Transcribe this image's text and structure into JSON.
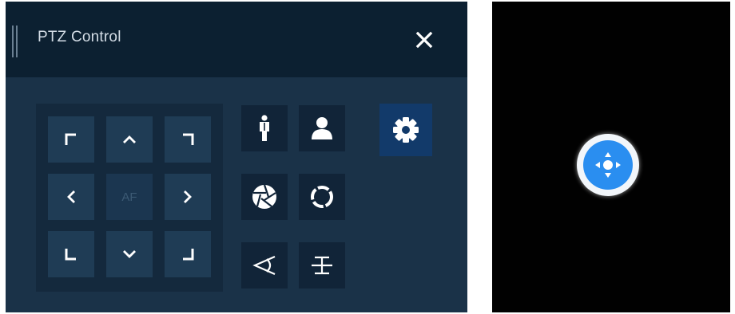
{
  "ptz": {
    "title": "PTZ Control",
    "direction_pad": {
      "center_label": "AF",
      "buttons": [
        "up-left",
        "up",
        "up-right",
        "left",
        "right",
        "down-left",
        "down",
        "down-right"
      ]
    },
    "lens_buttons": [
      "person-icon",
      "user-icon",
      "aperture-icon",
      "iris-ring-icon",
      "zoom-icon",
      "focus-icon"
    ],
    "settings_icon": "gear-icon",
    "close_icon": "close-icon"
  },
  "preview": {
    "floating_button_icon": "ptz-move-icon"
  },
  "colors": {
    "panel_bg": "#1a3248",
    "header_bg": "#0c2031",
    "button_bg": "#1f3c55",
    "settings_bg": "#123a6a",
    "accent_blue": "#2a8ef0",
    "icon_white": "#ffffff"
  }
}
